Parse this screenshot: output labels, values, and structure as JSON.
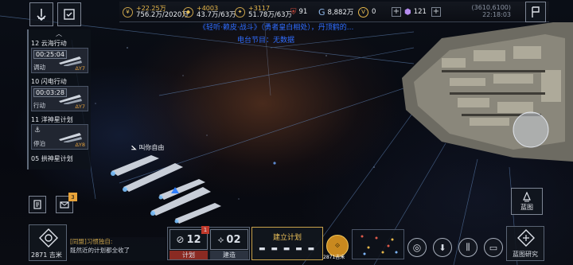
{
  "topbar": {
    "resources": [
      {
        "icon": "credits-icon",
        "delta": "+22.25万",
        "value": "756.2万/2020万"
      },
      {
        "icon": "metal-icon",
        "delta": "+4003",
        "value": "43.7万/63万"
      },
      {
        "icon": "crystal-icon",
        "delta": "+3117",
        "value": "51.78万/63万"
      }
    ],
    "energy": "91",
    "gems": "8,882万",
    "tokens": "0",
    "premium": "121",
    "coords": "(3610,6100)",
    "clock": "22:18:03"
  },
  "overlay_text": {
    "line1": "《轻听·赖皮·战斗》（勇者皇白相处），丹顶鹤的...",
    "line2": "电台节目：无数据"
  },
  "fleet_label": "叫你自由",
  "sidebar": [
    {
      "header": "12 云海行动",
      "timer": "00:25:04",
      "status": "调动",
      "sub": "ΔΥ7"
    },
    {
      "header": "10 闪电行动",
      "timer": "00:03:28",
      "status": "行动",
      "sub": "ΔΥ7"
    },
    {
      "header": "11 洋神星计划",
      "timer": "",
      "status": "停泊",
      "sub": "ΔΥ8"
    },
    {
      "header": "05 拱神星计划",
      "timer": "",
      "status": "",
      "sub": ""
    }
  ],
  "mail_badge": "3",
  "bottom": {
    "distance": "2871 吉米",
    "chat_channel": "[同盟]",
    "chat_name": "习惯独自:",
    "chat_msg": "既然近的计划都全收了",
    "plan_count": "12",
    "plan_badge": "1",
    "plan_label": "计划",
    "build_count": "02",
    "build_label": "建造",
    "build_plan_title": "建立计划",
    "mini_distance": "2871吉米",
    "blueprint_label": "蓝图",
    "blueprint_research_label": "蓝图研究"
  },
  "colors": {
    "accent": "#e8b84a",
    "alert": "#c0392b",
    "bg": "#05070c"
  }
}
